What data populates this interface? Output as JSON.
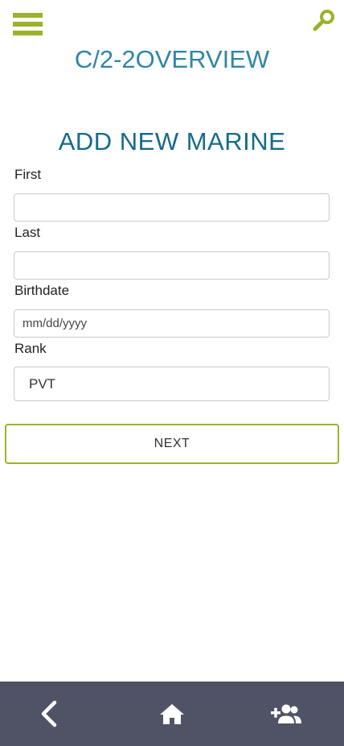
{
  "header": {
    "title": "C/2-2OVERVIEW",
    "menu_icon": "hamburger-menu-icon",
    "search_icon": "search-icon"
  },
  "form": {
    "title": "ADD NEW MARINE",
    "fields": {
      "first": {
        "label": "First",
        "value": "",
        "placeholder": ""
      },
      "last": {
        "label": "Last",
        "value": "",
        "placeholder": ""
      },
      "birthdate": {
        "label": "Birthdate",
        "value": "",
        "placeholder": "mm/dd/yyyy"
      },
      "rank": {
        "label": "Rank",
        "value": "PVT",
        "placeholder": ""
      }
    },
    "next_label": "NEXT"
  },
  "bottom_nav": {
    "items": [
      {
        "icon": "back-chevron-icon"
      },
      {
        "icon": "home-icon"
      },
      {
        "icon": "add-person-icon"
      }
    ]
  },
  "colors": {
    "accent": "#9cb22c",
    "title_blue": "#2f86a8",
    "heading_blue": "#146b8c",
    "nav_bg": "#505365"
  }
}
